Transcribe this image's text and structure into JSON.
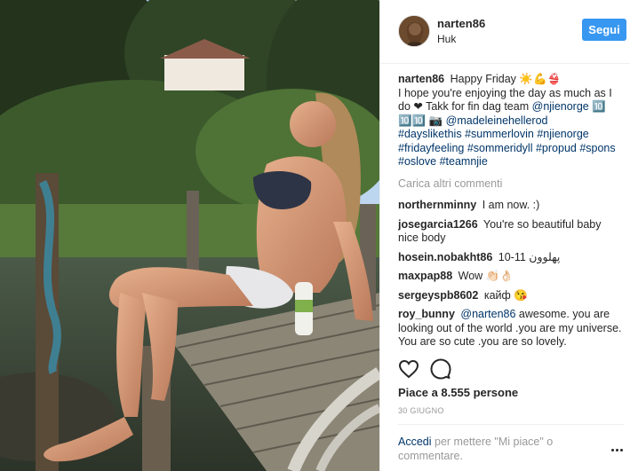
{
  "post": {
    "username": "narten86",
    "location": "Huk",
    "follow_label": "Segui",
    "caption": {
      "username": "narten86",
      "text_1": "Happy Friday ☀️💪👙",
      "text_2": "I hope you're enjoying the day as much as I do ❤ Takk for fin dag team",
      "tag_1": "@njienorge",
      "text_3": "🔟 🔟🔟 📷",
      "tag_2": "@madeleinehellerod",
      "hashtags": [
        "#dayslikethis",
        "#summerlovin",
        "#njienorge",
        "#fridayfeeling",
        "#sommeridyll",
        "#propud",
        "#spons",
        "#oslove",
        "#teamnjie"
      ]
    },
    "load_more": "Carica altri commenti",
    "comments": [
      {
        "user": "northernminny",
        "text": "I am now. :)"
      },
      {
        "user": "josegarcia1266",
        "text": "You're so beautiful baby nice body"
      },
      {
        "user": "hosein.nobakht86",
        "text": "10-11 پهلوون"
      },
      {
        "user": "maxpap88",
        "text": "Wow 👏🏻👌🏻"
      },
      {
        "user": "sergeyspb8602",
        "text": "кайф 😘"
      },
      {
        "user": "roy_bunny",
        "mention": "@narten86",
        "text": "awesome. you are looking out of the world .you are my universe. You are so cute .you are so lovely."
      }
    ],
    "likes": "Piace a 8.555 persone",
    "date": "30 GIUGNO",
    "login_link": "Accedi",
    "login_text": "per mettere \"Mi piace\" o commentare."
  },
  "icons": {
    "like": "heart-icon",
    "comment": "comment-bubble-icon",
    "more": "more-options-icon"
  },
  "colors": {
    "accent": "#3897f0",
    "link": "#003569",
    "muted": "#999999"
  }
}
